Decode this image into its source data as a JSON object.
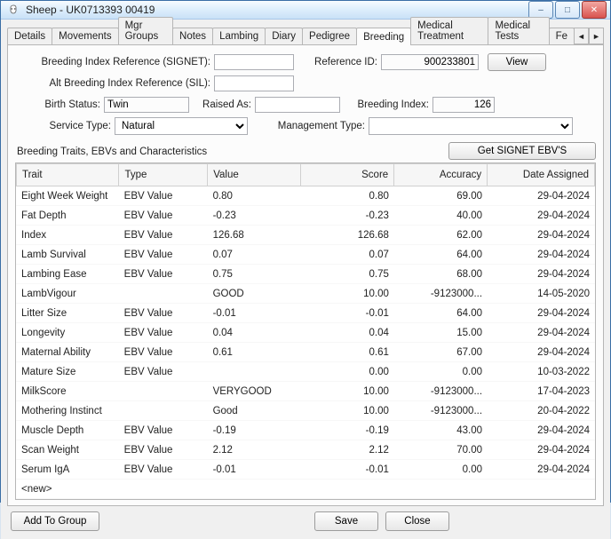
{
  "window": {
    "title": "Sheep - UK0713393 00419"
  },
  "win_buttons": {
    "min": "–",
    "max": "□",
    "close": "✕"
  },
  "tabs": [
    "Details",
    "Movements",
    "Mgr Groups",
    "Notes",
    "Lambing",
    "Diary",
    "Pedigree",
    "Breeding",
    "Medical Treatment",
    "Medical Tests",
    "Fe"
  ],
  "tab_scroll": {
    "left": "◄",
    "right": "►"
  },
  "form": {
    "bir_label": "Breeding Index Reference (SIGNET):",
    "bir_value": "",
    "refid_label": "Reference ID:",
    "refid_value": "900233801",
    "view_btn": "View",
    "alt_label": "Alt Breeding Index Reference (SIL):",
    "alt_value": "",
    "birth_status_label": "Birth Status:",
    "birth_status_value": "Twin",
    "raised_as_label": "Raised As:",
    "raised_as_value": "",
    "breeding_index_label": "Breeding Index:",
    "breeding_index_value": "126",
    "service_type_label": "Service Type:",
    "service_type_value": "Natural",
    "mgmt_type_label": "Management Type:",
    "mgmt_type_value": "",
    "section_title": "Breeding Traits, EBVs and Characteristics",
    "get_ebvs_btn": "Get SIGNET EBV'S"
  },
  "grid": {
    "columns": [
      "Trait",
      "Type",
      "Value",
      "Score",
      "Accuracy",
      "Date Assigned"
    ],
    "rows": [
      {
        "trait": "Eight Week Weight",
        "type": "EBV Value",
        "value": "0.80",
        "score": "0.80",
        "accuracy": "69.00",
        "date": "29-04-2024"
      },
      {
        "trait": "Fat Depth",
        "type": "EBV Value",
        "value": "-0.23",
        "score": "-0.23",
        "accuracy": "40.00",
        "date": "29-04-2024"
      },
      {
        "trait": "Index",
        "type": "EBV Value",
        "value": "126.68",
        "score": "126.68",
        "accuracy": "62.00",
        "date": "29-04-2024"
      },
      {
        "trait": "Lamb Survival",
        "type": "EBV Value",
        "value": "0.07",
        "score": "0.07",
        "accuracy": "64.00",
        "date": "29-04-2024"
      },
      {
        "trait": "Lambing Ease",
        "type": "EBV Value",
        "value": "0.75",
        "score": "0.75",
        "accuracy": "68.00",
        "date": "29-04-2024"
      },
      {
        "trait": "LambVigour",
        "type": "",
        "value": "GOOD",
        "score": "10.00",
        "accuracy": "-9123000...",
        "date": "14-05-2020"
      },
      {
        "trait": "Litter Size",
        "type": "EBV Value",
        "value": "-0.01",
        "score": "-0.01",
        "accuracy": "64.00",
        "date": "29-04-2024"
      },
      {
        "trait": "Longevity",
        "type": "EBV Value",
        "value": "0.04",
        "score": "0.04",
        "accuracy": "15.00",
        "date": "29-04-2024"
      },
      {
        "trait": "Maternal Ability",
        "type": "EBV Value",
        "value": "0.61",
        "score": "0.61",
        "accuracy": "67.00",
        "date": "29-04-2024"
      },
      {
        "trait": "Mature Size",
        "type": "EBV Value",
        "value": "",
        "score": "0.00",
        "accuracy": "0.00",
        "date": "10-03-2022"
      },
      {
        "trait": "MilkScore",
        "type": "",
        "value": "VERYGOOD",
        "score": "10.00",
        "accuracy": "-9123000...",
        "date": "17-04-2023"
      },
      {
        "trait": "Mothering Instinct",
        "type": "",
        "value": "Good",
        "score": "10.00",
        "accuracy": "-9123000...",
        "date": "20-04-2022"
      },
      {
        "trait": "Muscle Depth",
        "type": "EBV Value",
        "value": "-0.19",
        "score": "-0.19",
        "accuracy": "43.00",
        "date": "29-04-2024"
      },
      {
        "trait": "Scan Weight",
        "type": "EBV Value",
        "value": "2.12",
        "score": "2.12",
        "accuracy": "70.00",
        "date": "29-04-2024"
      },
      {
        "trait": "Serum IgA",
        "type": "EBV Value",
        "value": "-0.01",
        "score": "-0.01",
        "accuracy": "0.00",
        "date": "29-04-2024"
      },
      {
        "trait": "<new>",
        "type": "",
        "value": "",
        "score": "",
        "accuracy": "",
        "date": ""
      }
    ]
  },
  "footer": {
    "add_to_group": "Add To Group",
    "save": "Save",
    "close": "Close"
  }
}
